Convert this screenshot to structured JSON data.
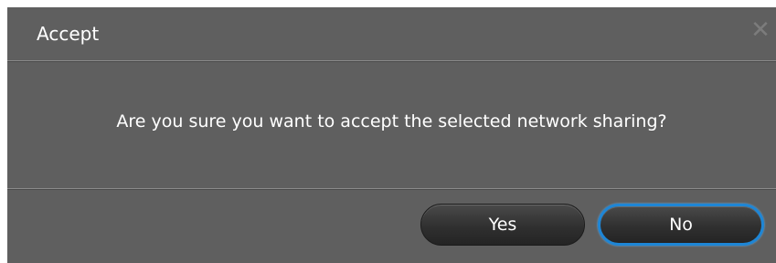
{
  "dialog": {
    "title": "Accept",
    "close_glyph": "✕",
    "message": "Are you sure you want to accept the selected network sharing?",
    "buttons": {
      "yes_label": "Yes",
      "no_label": "No"
    },
    "colors": {
      "background": "#5f5f5f",
      "focus_ring": "#1e86d6"
    },
    "icons": {
      "close": "close-icon"
    }
  }
}
